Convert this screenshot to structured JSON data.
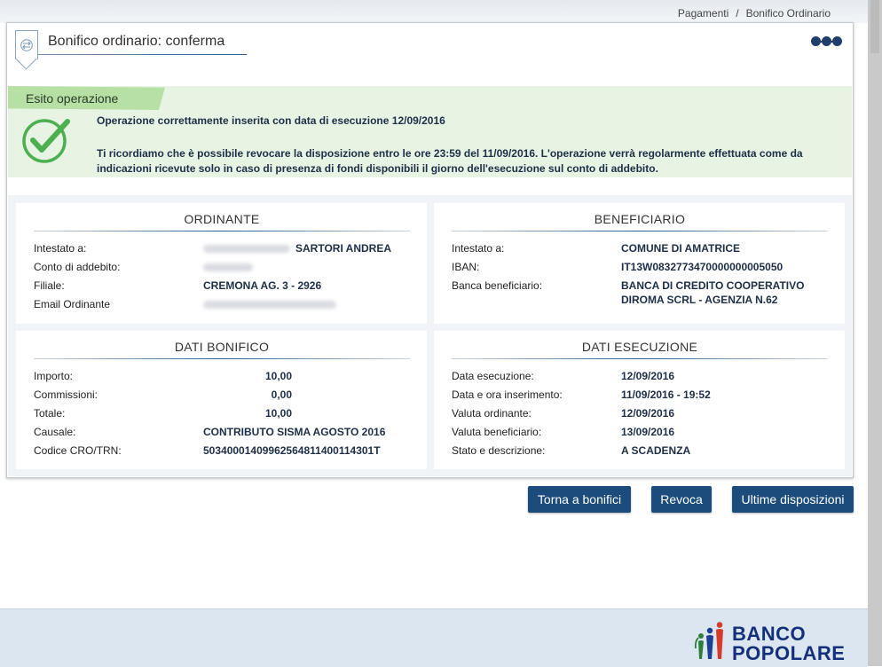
{
  "breadcrumb": {
    "section": "Pagamenti",
    "separator": "/",
    "page": "Bonifico Ordinario"
  },
  "header": {
    "title": "Bonifico ordinario: conferma"
  },
  "esito": {
    "tab_label": "Esito operazione",
    "message_1": "Operazione correttamente inserita con data di esecuzione 12/09/2016",
    "message_2": "Ti ricordiamo che è possibile revocare la disposizione entro le ore 23:59 del 11/09/2016. L'operazione verrà regolarmente effettuata come da indicazioni ricevute solo in caso di presenza di fondi disponibili il giorno dell'esecuzione sul conto di addebito."
  },
  "ordinante": {
    "title": "ORDINANTE",
    "rows": [
      {
        "label": "Intestato a:",
        "value": "SARTORI ANDREA"
      },
      {
        "label": "Conto di addebito:",
        "value": ""
      },
      {
        "label": "Filiale:",
        "value": "CREMONA AG. 3 - 2926"
      },
      {
        "label": "Email Ordinante",
        "value": ""
      }
    ]
  },
  "beneficiario": {
    "title": "BENEFICIARIO",
    "rows": [
      {
        "label": "Intestato a:",
        "value": "COMUNE DI AMATRICE"
      },
      {
        "label": "IBAN:",
        "value": "IT13W0832773470000000005050"
      },
      {
        "label": "Banca beneficiario:",
        "value": "BANCA DI CREDITO COOPERATIVO",
        "value_2": "DIROMA SCRL - AGENZIA N.62"
      }
    ]
  },
  "dati_bonifico": {
    "title": "DATI BONIFICO",
    "rows": [
      {
        "label": "Importo:",
        "value": "10,00"
      },
      {
        "label": "Commissioni:",
        "value": "0,00"
      },
      {
        "label": "Totale:",
        "value": "10,00"
      },
      {
        "label": "Causale:",
        "value": "CONTRIBUTO SISMA AGOSTO 2016"
      },
      {
        "label": "Codice CRO/TRN:",
        "value": "50340001409962564811400114301T"
      }
    ]
  },
  "dati_esecuzione": {
    "title": "DATI ESECUZIONE",
    "rows": [
      {
        "label": "Data esecuzione:",
        "value": "12/09/2016"
      },
      {
        "label": "Data e ora inserimento:",
        "value": "11/09/2016 - 19:52"
      },
      {
        "label": "Valuta ordinante:",
        "value": "12/09/2016"
      },
      {
        "label": "Valuta beneficiario:",
        "value": "13/09/2016"
      },
      {
        "label": "Stato e descrizione:",
        "value": "A SCADENZA"
      }
    ]
  },
  "buttons": {
    "back": "Torna a bonifici",
    "revoke": "Revoca",
    "latest": "Ultime disposizioni"
  },
  "footer": {
    "brand_line_1": "BANCO",
    "brand_line_2": "POPOLARE"
  },
  "icons": {
    "title_icon": "transfer-arrows-icon",
    "menu_icon": "three-dots-icon",
    "status_icon": "checkmark-icon",
    "logo_icon": "banco-popolare-logo-icon"
  },
  "colors": {
    "primary": "#1c4c7c",
    "success_bg": "#e8f4e3",
    "success_tab": "#b7e0a4",
    "check": "#4caf50",
    "brand": "#15307a"
  }
}
